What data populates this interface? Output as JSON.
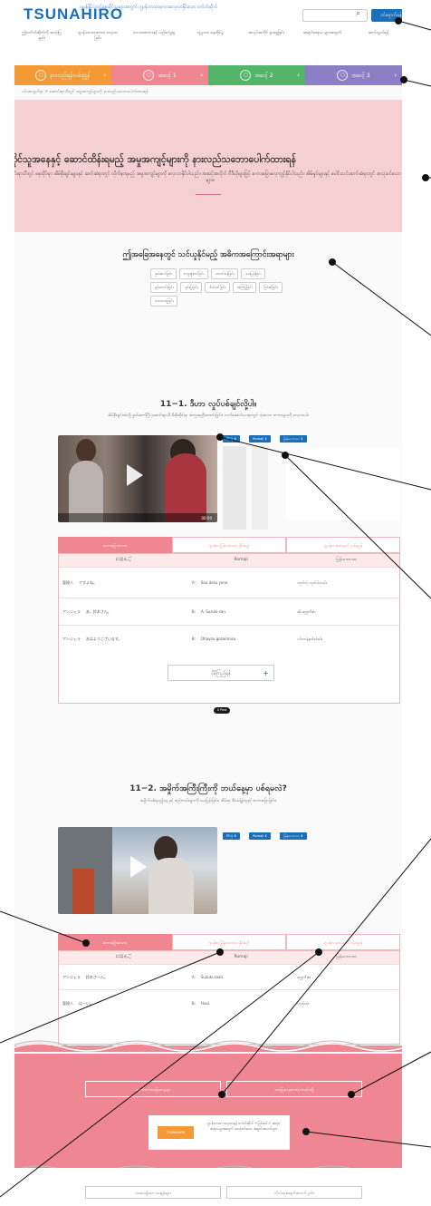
{
  "header": {
    "logo": "TSUNAHIRO",
    "tagline": "ဂျပန်နိုင်ငံတွင်နေထိုင်သူများအတွက် ဂျပန်ဘာသာစကားလေ့လာနိုင်သော ဝက်ဘ်ဆိုက်",
    "search_placeholder": "",
    "login_label": "ဝင်ရောက်ရန်",
    "nav": [
      "ဤဝက်ဘ်ဆိုက်ကို အသုံးပြုနည်း",
      "ဂျပန်ဘာသာစကား လေ့လာခြင်း",
      "ဘာသာစကားနှင့် ယဉ်ကျေးမှု",
      "လူမှုဘဝ နေထိုင်မှု",
      "အလုပ်အကိုင် ရှာဖွေခြင်း",
      "ဆရာ/ဆရာမ များအတွက်",
      "ဆက်သွယ်ရန်"
    ]
  },
  "levels": [
    {
      "label": "နားလည်ရန်လမ်းညွှန်",
      "color": "#f39a34",
      "icon": "compass-icon"
    },
    {
      "label": "အဆင့် 1",
      "color": "#ee8791",
      "icon": "level1-icon"
    },
    {
      "label": "အဆင့် 2",
      "color": "#52b56a",
      "icon": "level2-icon"
    },
    {
      "label": "အဆင့် 3",
      "color": "#8d7fc6",
      "icon": "level3-icon"
    }
  ],
  "breadcrumb": "ပင်မစာမျက်နှာ  >  ဆောင်းရာသီတွင် အမှုအကျင့်များကို နားလည်သဘောပေါက်ထားရန်",
  "hero": {
    "title": "နေထိုင်သူအနေနှင့် ဆောင်ထိန်းရမည့် အမှုအကျင့်များကို နားလည်သဘောပေါက်ထားရန်",
    "description": "ဆောင်းရာသီတွင် နေထိုင်ရာ အိမ်နီးချင်းများနှင့် ဆက်ဆံရာတွင် လိုက်နာရမည့် အမှုအကျင့်များကို လေ့လာနိုင်ပါသည်။ အဆင့်အလိုက် ဗီဒီယိုများဖြင့် စကားပြောလေ့ကျင့်နိုင်ပါသည်။ အိမ်ရှင်များနှင့် ပေါင်းသင်းဆက်ဆံရာတွင် အသုံးဝင်သော စကားစုများ။"
  },
  "topics": {
    "title": "ဤအခြေအနေတွင် သင်ယူနိုင်မည့် အဓိကအကြောင်းအရာများ",
    "tags": [
      "နှုတ်ဆက်ခြင်း",
      "ကျေးဇူးတင်ခြင်း",
      "တောင်းပန်ခြင်း",
      "မေးမြန်းခြင်း",
      "ခွင့်တောင်းခြင်း",
      "ရှင်းပြခြင်း",
      "ဖိတ်ခေါ်ခြင်း",
      "အကြံပြုခြင်း",
      "ငြင်းဆိုခြင်း",
      "သဘောတူခြင်း"
    ]
  },
  "lessons": [
    {
      "title": "11−1. ဒီဟာ လှုပ်ပစ်ချင်လို့ပါ။",
      "desc": "အိမ်နီးချင်းထံသို့ နှုတ်ဆက်ပြီး ဆောင်းရာသီ မီးဖိုဆိုင်ရာ အကူအညီတောင်းခြင်း။ လက်ဆောင်ပေးရာတွင် သုံးသော စကားများကို လေ့လာပါ။",
      "time": "00:00",
      "download_labels": [
        "ဗီဒီယို ⬇",
        "Romaji ⬇",
        "မြန်မာဘာသာ ⬇"
      ],
      "tabs": [
        "စကားပြောစာသား",
        "ဂျပန်စာ မြန်မာဘာသာ နှိုင်းယှဉ်",
        "ဂျပန်စာ အသံထွက် လမ်းညွှန်"
      ],
      "headers": [
        "にほんご",
        "Romaji",
        "မြန်မာဘာသာ"
      ],
      "rows": [
        [
          "管理人",
          "ですよね。",
          "Sou desu yone.",
          "ဟုတ်ကဲ့ ဟုတ်ပါတယ်။"
        ],
        [
          "アンジェラ",
          "あ、鈴木さん。",
          "A, Suzuki-san.",
          "အို၊ ဆူဇူကီးစံ။"
        ],
        [
          "アンジェラ",
          "おはようございます。",
          "Ohayou gozaimasu.",
          "မင်္ဂလာနံနက်ခင်းပါ။"
        ]
      ],
      "speakers": [
        "",
        "",
        ""
      ],
      "more_label": "ပိုမိုကြည့်ရန်",
      "post_label": "X Post"
    },
    {
      "title": "11−2. အမှိုက်အကြီးကြီးကို ဘယ်နေ့မှာ ပစ်ရမလဲ?",
      "desc": "အမှိုက်ပစ်ရမည့်နေ့ နှင့် စည်းကမ်းများကို မေးမြန်းခြင်း။ အိမ်ရာ စီမံခန့်ခွဲသူနှင့် စကားပြောခြင်း။",
      "download_labels": [
        "ဗီဒီယို ⬇",
        "Romaji ⬇",
        "မြန်မာဘာသာ ⬇"
      ],
      "tabs": [
        "စကားပြောစာသား",
        "ဂျပန်စာ မြန်မာဘာသာ နှိုင်းယှဉ်",
        "ဂျပန်စာ အသံထွက် လမ်းညွှန်"
      ],
      "headers": [
        "にほんご",
        "Romaji",
        "မြန်မာဘာသာ"
      ],
      "rows": [
        [
          "アンジェラ",
          "鈴木さーん。",
          "Suzuki-saan.",
          "ဆူဇူကီးစံ။"
        ],
        [
          "管理人",
          "はーい。",
          "Haai.",
          "ဟုတ်ကဲ့။"
        ]
      ]
    }
  ],
  "footer": {
    "buttons": [
      "နောက်ထပ်အခြေအနေများ",
      "အခြေအနေအားလုံး စာရင်းသို့"
    ],
    "banner_image": "TSUNAHIRO",
    "banner_text": "ဂျပန်ဘာသာ လေ့လာရန် ဝက်ဘ်ဆိုက် ＜ပြင်ဆင်＞ ဆရာ/ဆရာမများအတွက် အသုံးဝင်သော အချက်အလက်များ",
    "bottom_links": [
      "မေးလေ့ရှိသော မေးခွန်းများ",
      "ကိုယ်ရေးအချက်အလက် မူဝါဒ"
    ]
  },
  "colors": {
    "brand_blue": "#1b6fb8",
    "hero_pink": "#f6cfd3",
    "accent_pink": "#ee8791"
  }
}
